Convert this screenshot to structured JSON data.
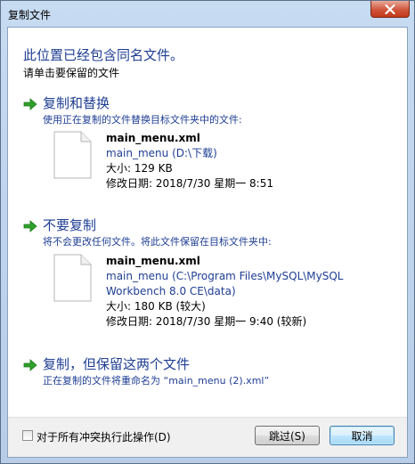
{
  "window": {
    "title": "复制文件"
  },
  "dialog": {
    "heading": "此位置已经包含同名文件。",
    "subheading": "请单击要保留的文件"
  },
  "options": {
    "replace": {
      "title": "复制和替换",
      "description": "使用正在复制的文件替换目标文件夹中的文件:",
      "file": {
        "name": "main_menu.xml",
        "path": "main_menu (D:\\下载)",
        "size": "大小: 129 KB",
        "modified": "修改日期: 2018/7/30 星期一 8:51"
      }
    },
    "skip": {
      "title": "不要复制",
      "description": "将不会更改任何文件。将此文件保留在目标文件夹中:",
      "file": {
        "name": "main_menu.xml",
        "path_line1": "main_menu (C:\\Program Files\\MySQL\\MySQL",
        "path_line2": "Workbench 8.0 CE\\data)",
        "size": "大小: 180 KB (较大)",
        "modified": "修改日期: 2018/7/30 星期一 9:40 (较新)"
      }
    },
    "keep_both": {
      "title": "复制，但保留这两个文件",
      "description": "正在复制的文件将重命名为 “main_menu (2).xml”"
    }
  },
  "footer": {
    "apply_all_label": "对于所有冲突执行此操作(D)",
    "skip_button": "跳过(S)",
    "cancel_button": "取消"
  },
  "colors": {
    "accent_text": "#1f3e93",
    "arrow_green": "#2ea02b",
    "close_button": "#c9432a"
  },
  "icons": {
    "arrow": "green-right-arrow-icon",
    "file": "blank-file-icon",
    "close": "close-icon"
  }
}
